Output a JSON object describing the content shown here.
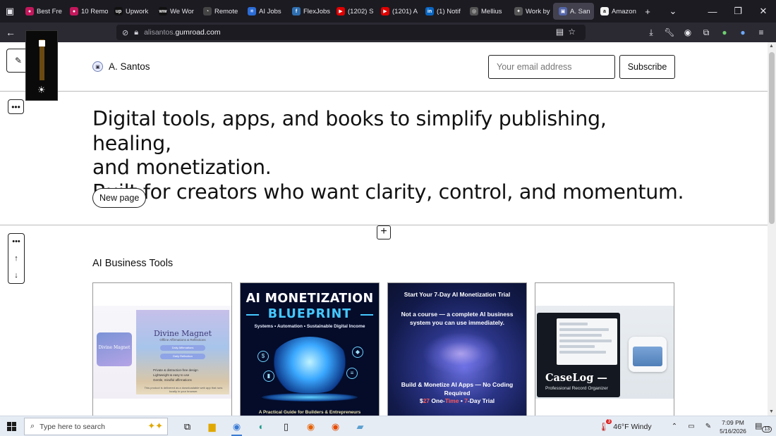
{
  "browser": {
    "tabs": [
      {
        "label": "Best Fre",
        "color": "#c2185b",
        "glyph": "●"
      },
      {
        "label": "10 Remo",
        "color": "#c2185b",
        "glyph": "●"
      },
      {
        "label": "Upwork",
        "color": "#111111",
        "glyph": "up"
      },
      {
        "label": "We Wor",
        "color": "#111111",
        "glyph": "ww"
      },
      {
        "label": "Remote",
        "color": "#444444",
        "glyph": "◔"
      },
      {
        "label": "AI Jobs",
        "color": "#2b6cd6",
        "glyph": "✳"
      },
      {
        "label": "FlexJobs",
        "color": "#2f6fb0",
        "glyph": "f"
      },
      {
        "label": "(1202) S",
        "color": "#e00000",
        "glyph": "▶"
      },
      {
        "label": "(1201) A",
        "color": "#e00000",
        "glyph": "▶"
      },
      {
        "label": "(1) Notif",
        "color": "#0a66c2",
        "glyph": "in"
      },
      {
        "label": "Mellius",
        "color": "#555555",
        "glyph": "◎"
      },
      {
        "label": "Work by",
        "color": "#555555",
        "glyph": "✦"
      },
      {
        "label": "A. San",
        "color": "#5566aa",
        "glyph": "▣",
        "active": true
      },
      {
        "label": "Amazon",
        "color": "#f3f3f3",
        "glyph": "a"
      }
    ],
    "new_tab": "+",
    "tab_list": "⌄",
    "minimize": "—",
    "restore": "❐",
    "close": "✕",
    "url_domain": "alisantos.",
    "url_host": "gumroad.com"
  },
  "site": {
    "brand": "A. Santos",
    "email_placeholder": "Your email address",
    "subscribe_label": "Subscribe",
    "hero_lines": [
      "Digital tools, apps, and books to simplify publishing, healing,",
      "and monetization.",
      "Built for creators who want clarity, control, and momentum."
    ],
    "new_page_label": "New page",
    "section_title": "AI Business Tools"
  },
  "cards": {
    "c1": {
      "small_title": "Divine Magnet",
      "title": "Divine Magnet",
      "subtitle": "Offline Affirmations & Reflections",
      "pill1": "Daily Affirmations",
      "pill2": "Daily Reflection",
      "list": [
        "Private & distraction-free design",
        "Lightweight & easy to use",
        "Gentle, mindful affirmations"
      ],
      "footer": "This product is delivered as a downloadable web app that runs locally in your browser."
    },
    "c2": {
      "title1": "AI MONETIZATION",
      "title2": "BLUEPRINT",
      "subtitle": "Systems • Automation • Sustainable Digital Income",
      "footer": "A Practical Guide for Builders & Entrepreneurs"
    },
    "c3": {
      "header": "Start Your 7-Day AI Monetization Trial",
      "tagline": "Not a course — a complete AI business system you can use immediately.",
      "bottom": "Build & Monetize AI Apps — No Coding Required",
      "price_a": "$",
      "price_b": "27",
      "price_c": " One-",
      "price_d": "Time",
      "price_e": " • ",
      "price_f": "7",
      "price_g": "-Day Trial"
    },
    "c4": {
      "title": "CaseLog —",
      "subtitle": "Professional Record Organizer"
    }
  },
  "taskbar": {
    "search_placeholder": "Type here to search",
    "weather_count": "3",
    "weather": "46°F  Windy",
    "time": "7:09 PM",
    "date": "5/16/2026",
    "notification_count": "13"
  }
}
